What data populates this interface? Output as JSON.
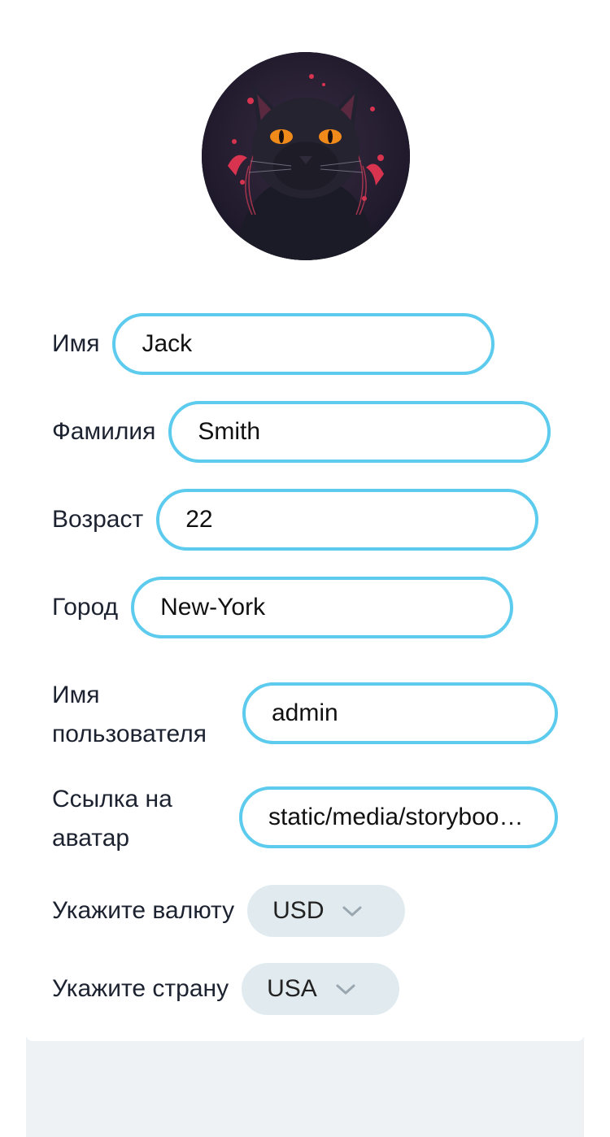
{
  "profile": {
    "avatar_alt": "avatar",
    "fields": {
      "first_name": {
        "label": "Имя",
        "value": "Jack"
      },
      "last_name": {
        "label": "Фамилия",
        "value": "Smith"
      },
      "age": {
        "label": "Возраст",
        "value": "22"
      },
      "city": {
        "label": "Город",
        "value": "New-York"
      },
      "username": {
        "label": "Имя пользователя",
        "value": "admin"
      },
      "avatar_link": {
        "label": "Ссылка на аватар",
        "value": "static/media/storybook-avatar.jpg"
      }
    },
    "currency": {
      "label": "Укажите валюту",
      "value": "USD"
    },
    "country": {
      "label": "Укажите страну",
      "value": "USA"
    }
  },
  "colors": {
    "input_border": "#5ccbee",
    "select_bg": "#e1ebef",
    "page_bg": "#eef2f5"
  }
}
